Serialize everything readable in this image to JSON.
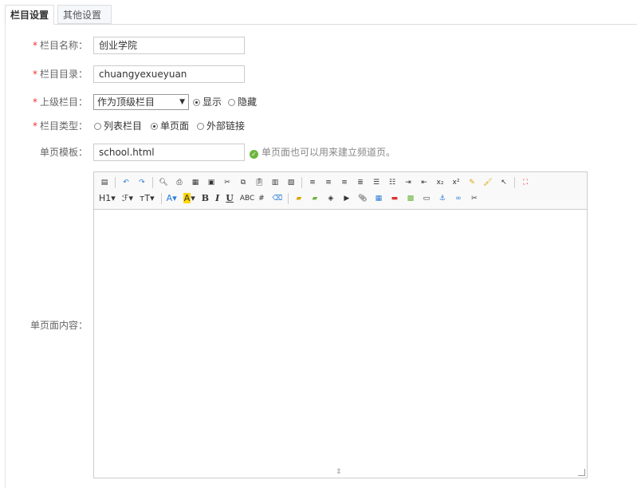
{
  "tabs": {
    "active": "栏目设置",
    "other": "其他设置"
  },
  "form": {
    "required_mark": "*",
    "name": {
      "label": "栏目名称：",
      "value": "创业学院"
    },
    "dir": {
      "label": "栏目目录：",
      "value": "chuangyexueyuan"
    },
    "parent": {
      "label": "上级栏目：",
      "selected": "作为顶级栏目",
      "show_label": "显示",
      "hide_label": "隐藏"
    },
    "type": {
      "label": "栏目类型：",
      "list_label": "列表栏目",
      "single_label": "单页面",
      "external_label": "外部链接"
    },
    "template": {
      "label": "单页模板：",
      "value": "school.html",
      "hint": "单页面也可以用来建立频道页。"
    },
    "content": {
      "label": "单页面内容："
    }
  },
  "toolbar": {
    "heading": "H1",
    "font": "ℱ",
    "size": "тT",
    "fontcolor": "A",
    "bgcolor": "A",
    "bold": "B",
    "italic": "I",
    "underline": "U"
  },
  "colors": {
    "accent": "#2b7bd6",
    "required": "#e33333",
    "ok": "#6cb63e",
    "border": "#cccccc"
  }
}
